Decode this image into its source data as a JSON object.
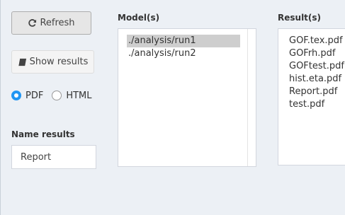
{
  "controls": {
    "refresh_label": "Refresh",
    "show_results_label": "Show results"
  },
  "format": {
    "options": [
      {
        "label": "PDF",
        "checked": true
      },
      {
        "label": "HTML",
        "checked": false
      }
    ]
  },
  "name_results": {
    "label": "Name results",
    "value": "Report"
  },
  "models": {
    "label": "Model(s)",
    "items": [
      "./analysis/run1",
      "./analysis/run2"
    ],
    "selected_index": 0
  },
  "results": {
    "label": "Result(s)",
    "items": [
      "GOF.tex.pdf",
      "GOFrh.pdf",
      "GOFtest.pdf",
      "hist.eta.pdf",
      "Report.pdf",
      "test.pdf"
    ]
  },
  "icons": {
    "refresh": "refresh-icon",
    "show_results": "book-icon"
  },
  "colors": {
    "radio_checked": "#2196f3",
    "selected_row": "#cecece",
    "background": "#ecf0f5"
  }
}
